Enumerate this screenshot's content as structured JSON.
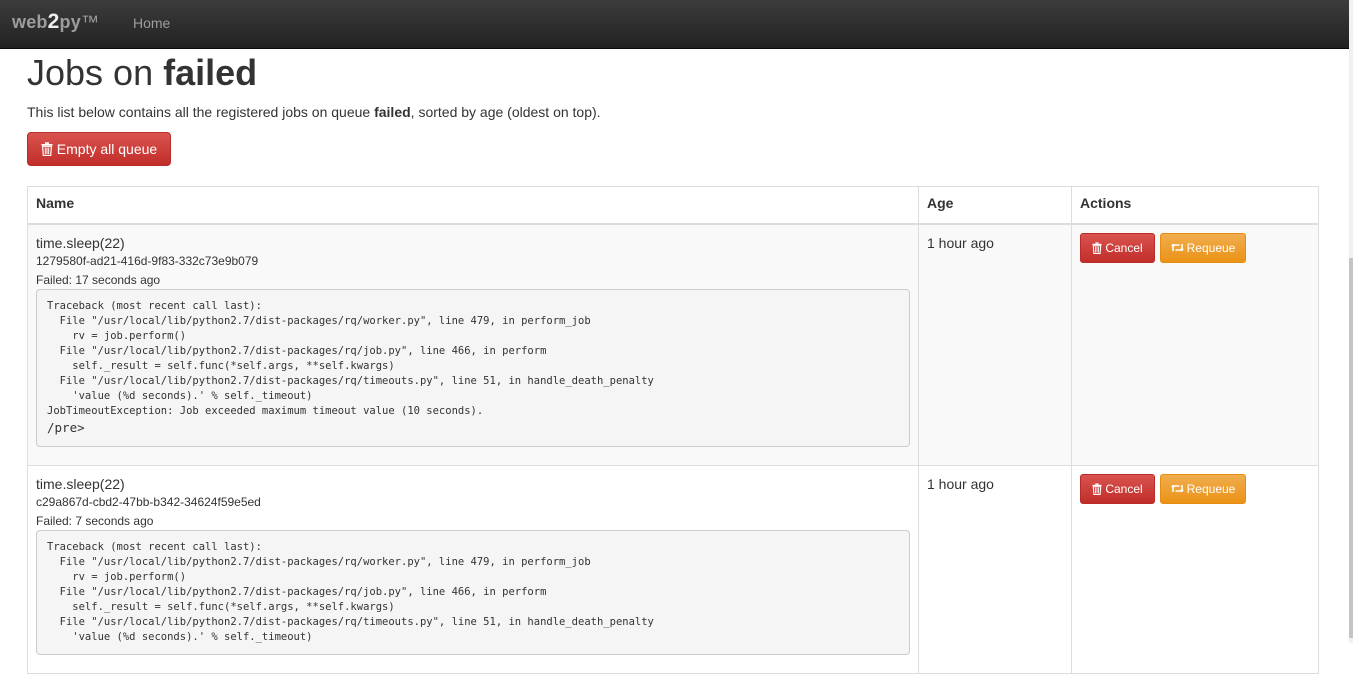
{
  "navbar": {
    "brand_prefix": "web",
    "brand_number": "2",
    "brand_suffix": "py",
    "brand_tm": "™",
    "home_label": "Home"
  },
  "page": {
    "title_prefix": "Jobs on ",
    "title_queue": "failed",
    "description_prefix": "This list below contains all the registered jobs on queue ",
    "description_queue": "failed",
    "description_suffix": ", sorted by age (oldest on top).",
    "empty_button_label": "Empty all queue"
  },
  "table": {
    "headers": {
      "name": "Name",
      "age": "Age",
      "actions": "Actions"
    },
    "cancel_label": "Cancel",
    "requeue_label": "Requeue",
    "rows": [
      {
        "name": "time.sleep(22)",
        "id": "1279580f-ad21-416d-9f83-332c73e9b079",
        "failed": "Failed: 17 seconds ago",
        "traceback": "Traceback (most recent call last):\n  File \"/usr/local/lib/python2.7/dist-packages/rq/worker.py\", line 479, in perform_job\n    rv = job.perform()\n  File \"/usr/local/lib/python2.7/dist-packages/rq/job.py\", line 466, in perform\n    self._result = self.func(*self.args, **self.kwargs)\n  File \"/usr/local/lib/python2.7/dist-packages/rq/timeouts.py\", line 51, in handle_death_penalty\n    'value (%d seconds).' % self._timeout)\nJobTimeoutException: Job exceeded maximum timeout value (10 seconds).",
        "traceback_end": "/pre>",
        "age": "1 hour ago"
      },
      {
        "name": "time.sleep(22)",
        "id": "c29a867d-cbd2-47bb-b342-34624f59e5ed",
        "failed": "Failed: 7 seconds ago",
        "traceback": "Traceback (most recent call last):\n  File \"/usr/local/lib/python2.7/dist-packages/rq/worker.py\", line 479, in perform_job\n    rv = job.perform()\n  File \"/usr/local/lib/python2.7/dist-packages/rq/job.py\", line 466, in perform\n    self._result = self.func(*self.args, **self.kwargs)\n  File \"/usr/local/lib/python2.7/dist-packages/rq/timeouts.py\", line 51, in handle_death_penalty\n    'value (%d seconds).' % self._timeout)",
        "age": "1 hour ago"
      }
    ]
  },
  "icons": {
    "empty_button_icon": "trash-icon",
    "cancel_icon": "trash-icon",
    "requeue_icon": "retweet-icon"
  },
  "colors": {
    "navbar": "#222222",
    "danger": "#d9534f",
    "warning": "#f0ad4e"
  }
}
